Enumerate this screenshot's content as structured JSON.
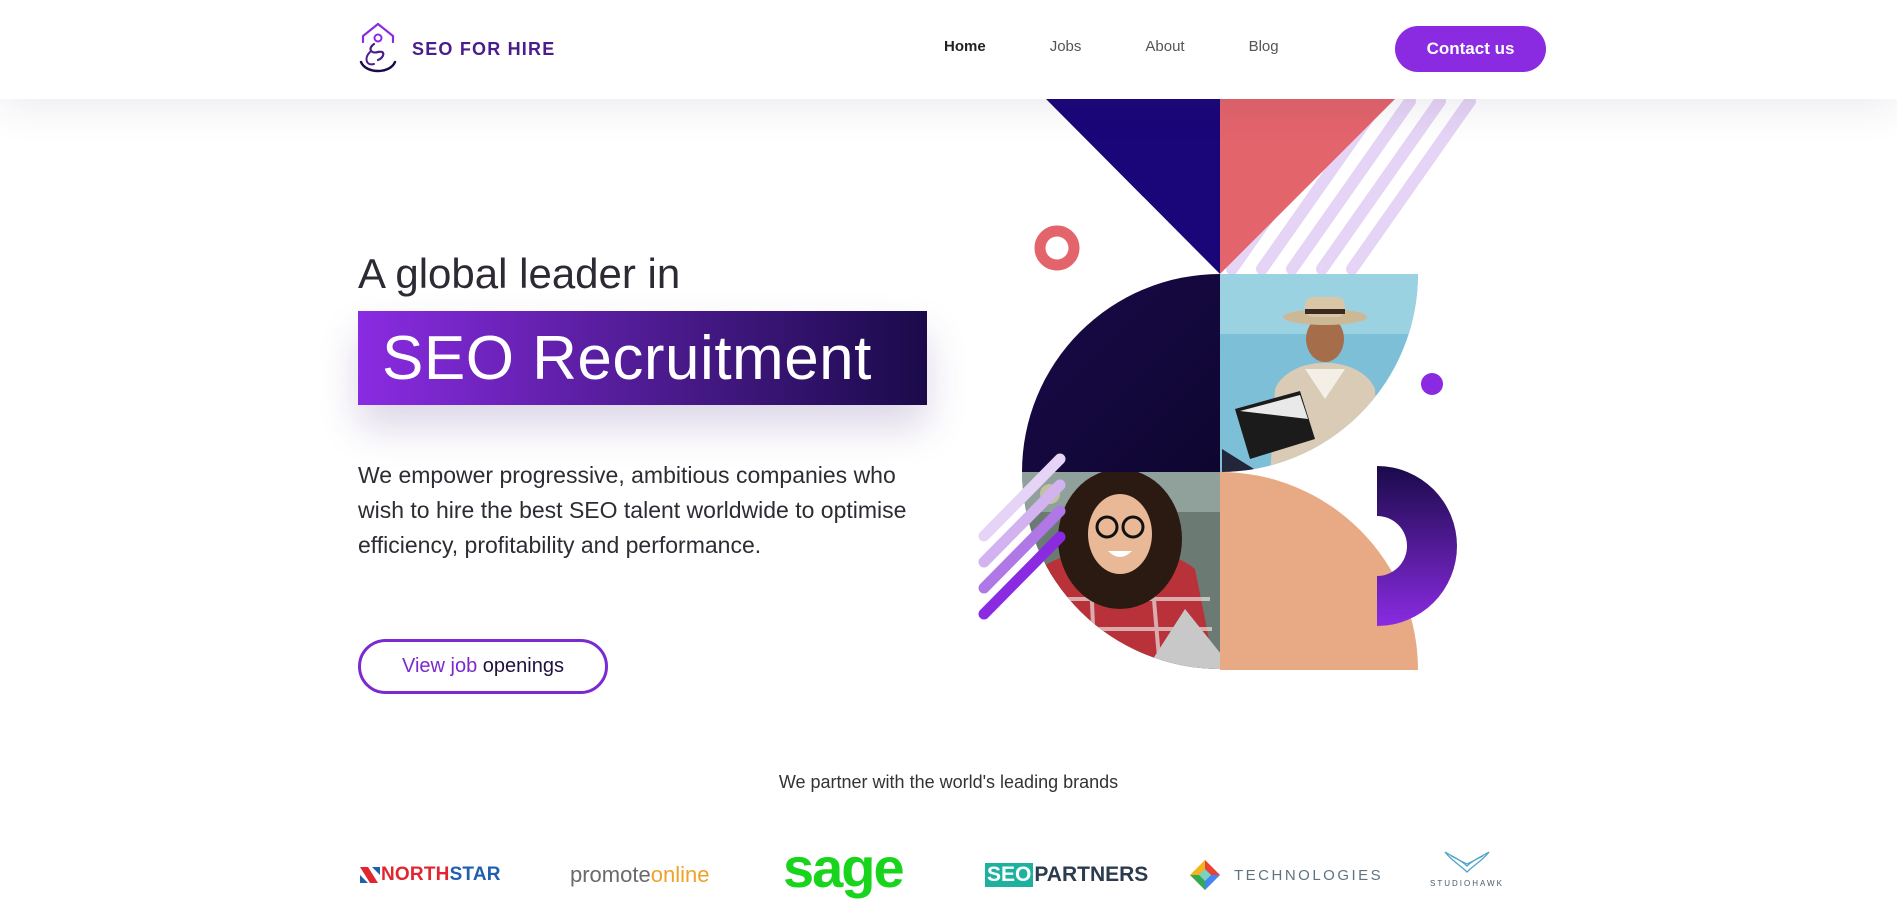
{
  "brand": {
    "name": "SEO FOR HIRE"
  },
  "nav": {
    "items": [
      {
        "label": "Home",
        "active": true
      },
      {
        "label": "Jobs",
        "active": false
      },
      {
        "label": "About",
        "active": false
      },
      {
        "label": "Blog",
        "active": false
      }
    ],
    "contact_label": "Contact us"
  },
  "hero": {
    "pre_title": "A global leader in",
    "title": "SEO Recruitment",
    "description": "We empower progressive, ambitious companies who wish to hire the best SEO talent worldwide to optimise efficiency, profitability and performance.",
    "cta_part1": "View job ",
    "cta_part2": "openings"
  },
  "partners": {
    "heading": "We partner with the world's leading brands",
    "logos": {
      "northstar_a": "NORTH",
      "northstar_b": "STAR",
      "promote_a": "promote",
      "promote_b": "online",
      "sage": "sage",
      "seo_box": "SEO",
      "seo_rest": "PARTNERS",
      "tech": "TECHNOLOGIES",
      "hawk": "STUDIOHAWK"
    }
  },
  "colors": {
    "purple": "#8a2be2",
    "navy": "#1a0a4a",
    "coral": "#e4646c",
    "peach": "#e8aa85",
    "lavender": "#e5d4f5"
  }
}
